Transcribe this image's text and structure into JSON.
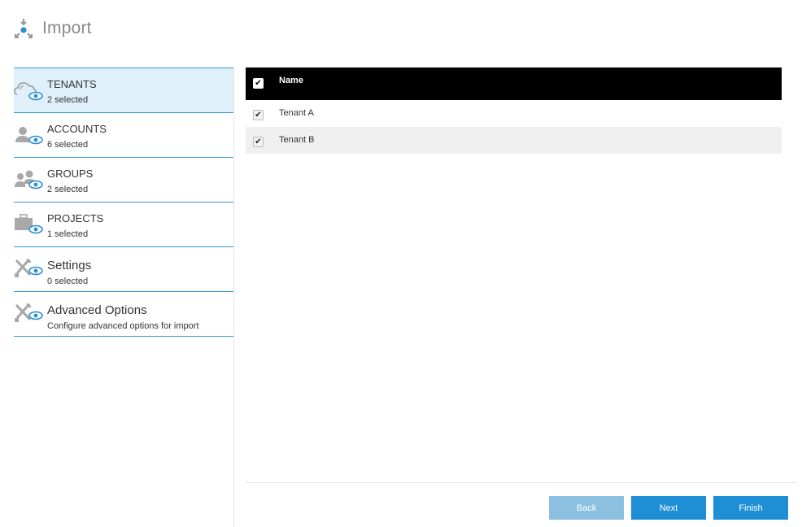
{
  "header": {
    "title": "Import",
    "icon": "import-icon"
  },
  "sidebar": {
    "items": [
      {
        "label": "TENANTS",
        "sub": "2 selected",
        "icon": "tenants-cloud-eye-icon",
        "active": true
      },
      {
        "label": "ACCOUNTS",
        "sub": "6 selected",
        "icon": "accounts-user-eye-icon"
      },
      {
        "label": "GROUPS",
        "sub": "2 selected",
        "icon": "groups-users-eye-icon"
      },
      {
        "label": "PROJECTS",
        "sub": "1 selected",
        "icon": "projects-briefcase-eye-icon"
      },
      {
        "label": "Settings",
        "sub": "0 selected",
        "icon": "settings-tools-eye-icon"
      },
      {
        "label": "Advanced Options",
        "sub": "Configure advanced options for import",
        "icon": "advanced-tools-eye-icon"
      }
    ]
  },
  "table": {
    "header": {
      "name": "Name",
      "checked": true
    },
    "rows": [
      {
        "name": "Tenant A",
        "checked": true
      },
      {
        "name": "Tenant B",
        "checked": true
      }
    ]
  },
  "footer": {
    "back": "Back",
    "next": "Next",
    "finish": "Finish"
  },
  "colors": {
    "accent": "#1e8fd6",
    "accent_disabled": "#8cc0e0",
    "active_bg": "#dff0fb",
    "divider": "#2f9bd8"
  }
}
